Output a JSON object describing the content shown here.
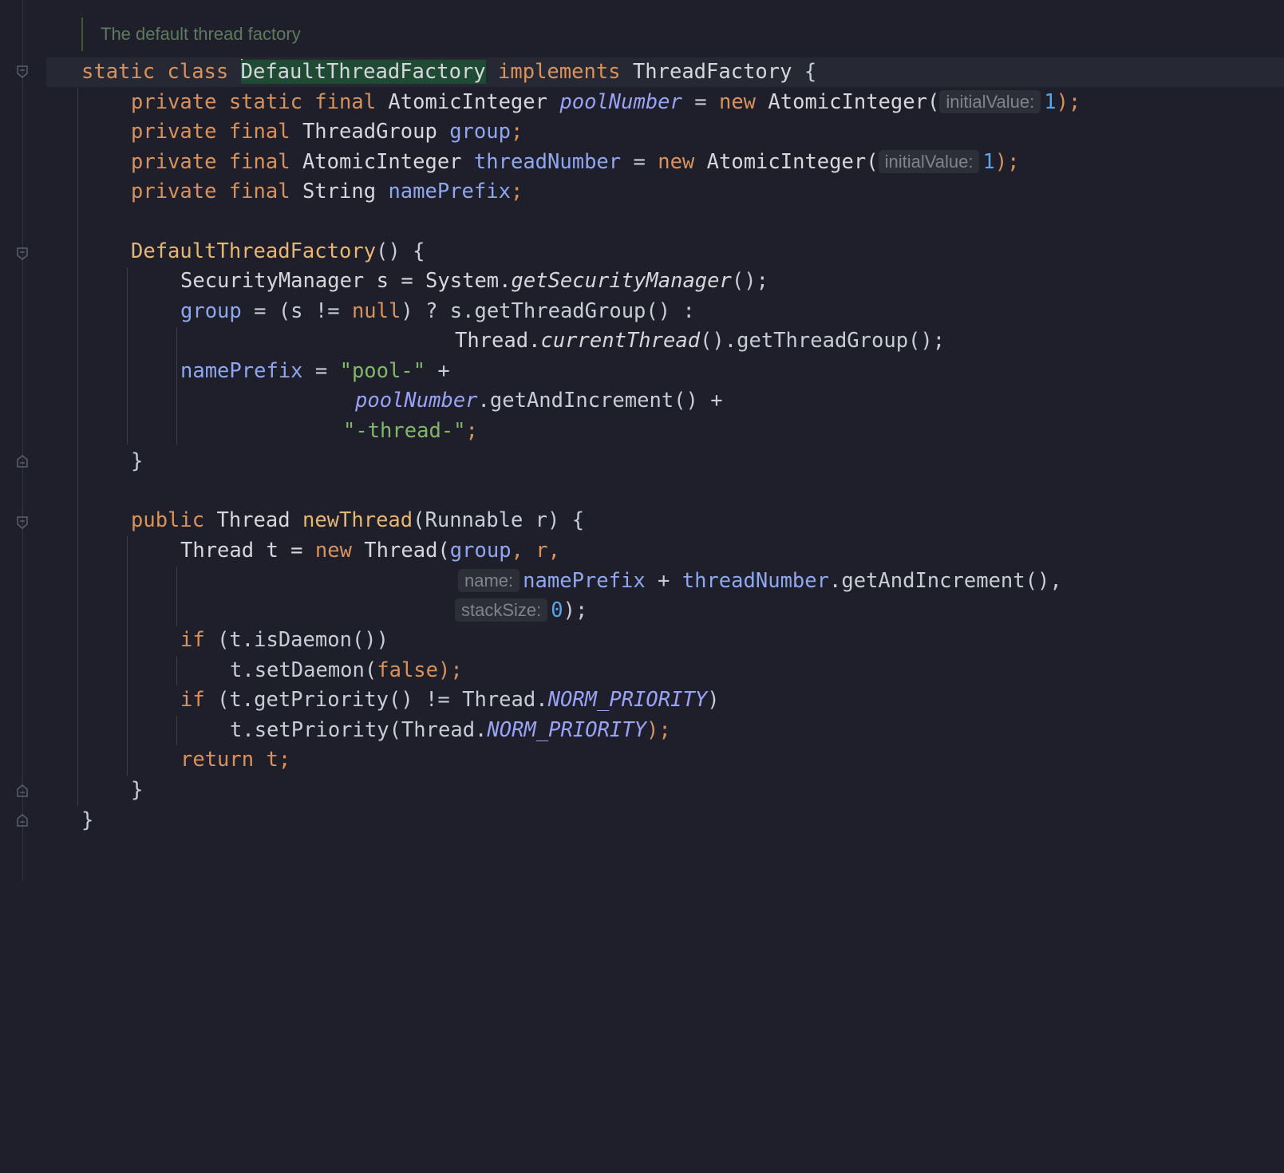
{
  "editor": {
    "doc_comment": "The default thread factory",
    "class_decl": {
      "kw_static": "static",
      "kw_class": "class",
      "class_name": "DefaultThreadFactory",
      "kw_implements": "implements",
      "interface": "ThreadFactory",
      "brace": "{"
    },
    "fields": {
      "f1": {
        "mods": "private static final",
        "type": "AtomicInteger",
        "name": "poolNumber",
        "eq": "=",
        "kw_new": "new",
        "ctor": "AtomicInteger(",
        "hint": "initialValue:",
        "value": "1",
        "end": ");"
      },
      "f2": {
        "mods": "private final",
        "type": "ThreadGroup",
        "name": "group",
        "end": ";"
      },
      "f3": {
        "mods": "private final",
        "type": "AtomicInteger",
        "name": "threadNumber",
        "eq": "=",
        "kw_new": "new",
        "ctor": "AtomicInteger(",
        "hint": "initialValue:",
        "value": "1",
        "end": ");"
      },
      "f4": {
        "mods": "private final",
        "type": "String",
        "name": "namePrefix",
        "end": ";"
      }
    },
    "ctor": {
      "name": "DefaultThreadFactory",
      "sig_rest": "() {",
      "l1_a": "SecurityManager s = System.",
      "l1_b": "getSecurityManager",
      "l1_c": "();",
      "l2_field": "group",
      "l2_a": " = (s != ",
      "l2_null": "null",
      "l2_b": ") ? s.getThreadGroup() :",
      "l3_a": "Thread.",
      "l3_b": "currentThread",
      "l3_c": "().getThreadGroup();",
      "l4_field": "namePrefix",
      "l4_a": " = ",
      "l4_str": "\"pool-\"",
      "l4_b": " +",
      "l5_field": "poolNumber",
      "l5_a": ".getAndIncrement() +",
      "l6_str": "\"-thread-\"",
      "l6_end": ";",
      "close": "}"
    },
    "method": {
      "kw_public": "public",
      "ret": "Thread",
      "name": "newThread",
      "params": "(Runnable r) {",
      "l1_a": "Thread t = ",
      "l1_new": "new",
      "l1_b": " Thread(",
      "l1_group": "group",
      "l1_c": ", r,",
      "l2_hint": "name:",
      "l2_field": "namePrefix",
      "l2_a": " + ",
      "l2_field2": "threadNumber",
      "l2_b": ".getAndIncrement(),",
      "l3_hint": "stackSize:",
      "l3_num": "0",
      "l3_end": ");",
      "l4_if": "if",
      "l4_a": " (t.isDaemon())",
      "l5_a": "t.setDaemon(",
      "l5_false": "false",
      "l5_end": ");",
      "l6_if": "if",
      "l6_a": " (t.getPriority() != Thread.",
      "l6_const": "NORM_PRIORITY",
      "l6_end": ")",
      "l7_a": "t.setPriority(Thread.",
      "l7_const": "NORM_PRIORITY",
      "l7_end": ");",
      "l8_return": "return",
      "l8_a": " t;",
      "close": "}"
    },
    "class_close": "}"
  }
}
